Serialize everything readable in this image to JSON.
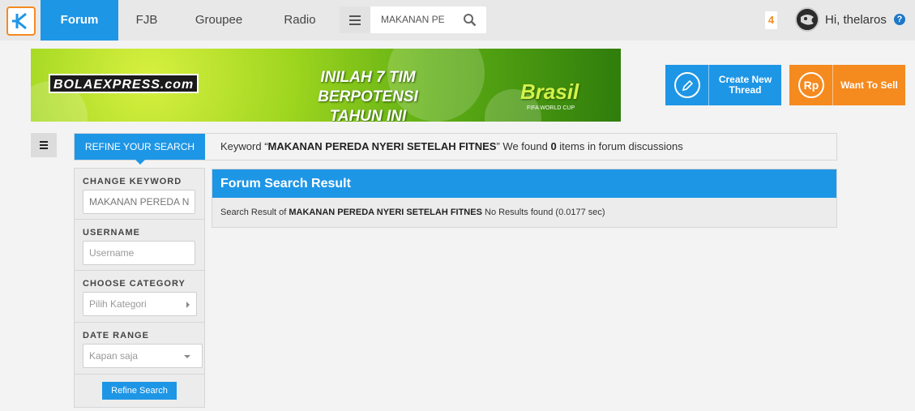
{
  "nav": {
    "items": [
      {
        "label": "Forum",
        "active": true
      },
      {
        "label": "FJB",
        "active": false
      },
      {
        "label": "Groupee",
        "active": false
      },
      {
        "label": "Radio",
        "active": false
      }
    ],
    "search_value": "MAKANAN PE",
    "notification_count": "4",
    "greeting": "Hi, thelaros",
    "help": "?"
  },
  "banner": {
    "logo_text": "BOLAEXPRESS.com",
    "headline_line1": "INILAH 7 TIM BERPOTENSI",
    "headline_line2": "TAHUN INI",
    "brand": "Brasil",
    "brand_sub": "FIFA WORLD CUP"
  },
  "actions": {
    "create_label": "Create New Thread",
    "sell_icon": "Rp",
    "sell_label": "Want To Sell"
  },
  "refine": {
    "tab_label": "REFINE YOUR SEARCH",
    "keyword_prefix": "Keyword “",
    "keyword": "MAKANAN PEREDA NYERI SETELAH FITNES",
    "keyword_mid": "” We found ",
    "count": "0",
    "keyword_suffix": " items in forum discussions"
  },
  "filters": {
    "change_keyword_label": "CHANGE KEYWORD",
    "change_keyword_value": "MAKANAN PEREDA N",
    "username_label": "USERNAME",
    "username_placeholder": "Username",
    "category_label": "CHOOSE CATEGORY",
    "category_value": "Pilih Kategori",
    "date_label": "DATE RANGE",
    "date_value": "Kapan saja",
    "refine_button": "Refine Search"
  },
  "results": {
    "header": "Forum Search Result",
    "prefix": "Search Result of ",
    "keyword": "MAKANAN PEREDA NYERI SETELAH FITNES",
    "suffix": " No Results found (0.0177 sec)"
  },
  "colors": {
    "primary": "#1e96e6",
    "accent": "#f58a1f"
  }
}
